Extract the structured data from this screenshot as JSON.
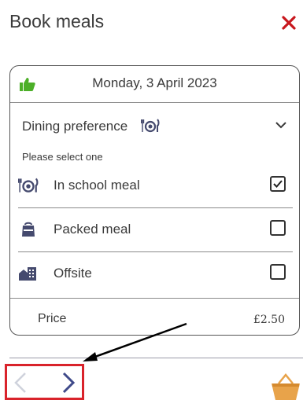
{
  "header": {
    "title": "Book meals",
    "close_icon": "close-icon"
  },
  "card": {
    "date": "Monday, 3 April 2023",
    "thumb_icon": "thumbs-up-icon",
    "preference_label": "Dining preference",
    "preference_icon": "dining-icon",
    "hint": "Please select one",
    "options": [
      {
        "label": "In school meal",
        "icon": "dining-icon",
        "checked": true
      },
      {
        "label": "Packed meal",
        "icon": "lunchbag-icon",
        "checked": false
      },
      {
        "label": "Offsite",
        "icon": "building-icon",
        "checked": false
      }
    ],
    "price_label": "Price",
    "price_value": "£2.50"
  },
  "colors": {
    "close": "#c8171d",
    "thumb": "#4caf28",
    "nav_next": "#3f4a8a",
    "nav_prev": "#cfd2dc",
    "highlight": "#d9232b",
    "basket": "#e8a34a"
  },
  "footer": {
    "prev_icon": "chevron-left-icon",
    "next_icon": "chevron-right-icon",
    "basket_icon": "basket-icon"
  }
}
